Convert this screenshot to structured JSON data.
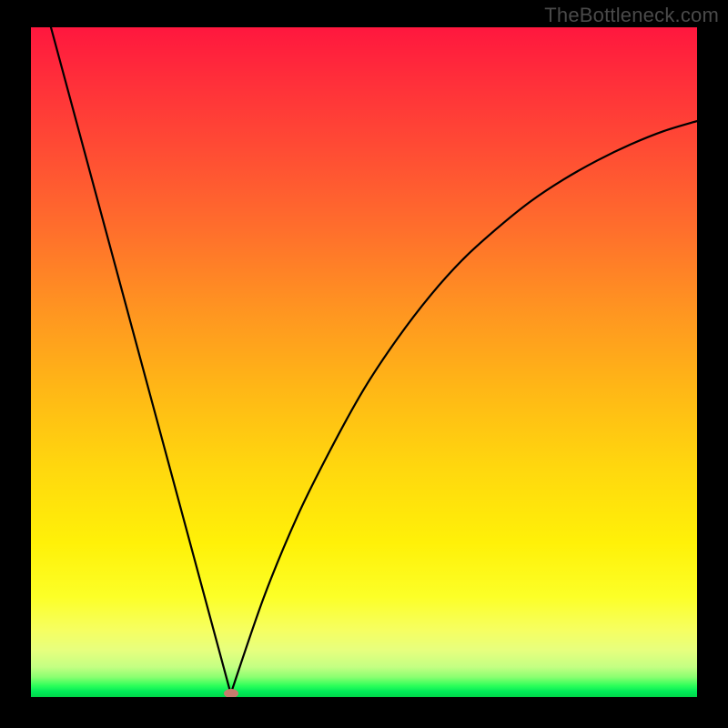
{
  "watermark": "TheBottleneck.com",
  "chart_data": {
    "type": "line",
    "title": "",
    "xlabel": "",
    "ylabel": "",
    "xlim": [
      0,
      100
    ],
    "ylim": [
      0,
      100
    ],
    "grid": false,
    "legend": false,
    "notes": "V-shaped bottleneck curve over a red→green vertical gradient. Minimum (marker) near x≈30, y≈0. Left branch is steep/near-linear from top-left to the minimum; right branch rises and bends toward the upper right.",
    "series": [
      {
        "name": "left-branch",
        "x": [
          3,
          30
        ],
        "values": [
          100,
          0.5
        ]
      },
      {
        "name": "right-branch",
        "x": [
          30,
          35,
          40,
          45,
          50,
          55,
          60,
          65,
          70,
          75,
          80,
          85,
          90,
          95,
          100
        ],
        "values": [
          0.5,
          15,
          27,
          37,
          46,
          53.5,
          60,
          65.5,
          70,
          74,
          77.3,
          80.1,
          82.5,
          84.5,
          86
        ]
      }
    ],
    "marker": {
      "x": 30,
      "y": 0.5,
      "color": "#c77b6e"
    },
    "background_gradient": {
      "direction": "vertical",
      "stops": [
        {
          "pct": 0,
          "color": "#ff173e"
        },
        {
          "pct": 30,
          "color": "#ff6e2c"
        },
        {
          "pct": 66,
          "color": "#ffd80e"
        },
        {
          "pct": 90,
          "color": "#f6ff61"
        },
        {
          "pct": 100,
          "color": "#00d648"
        }
      ]
    }
  }
}
